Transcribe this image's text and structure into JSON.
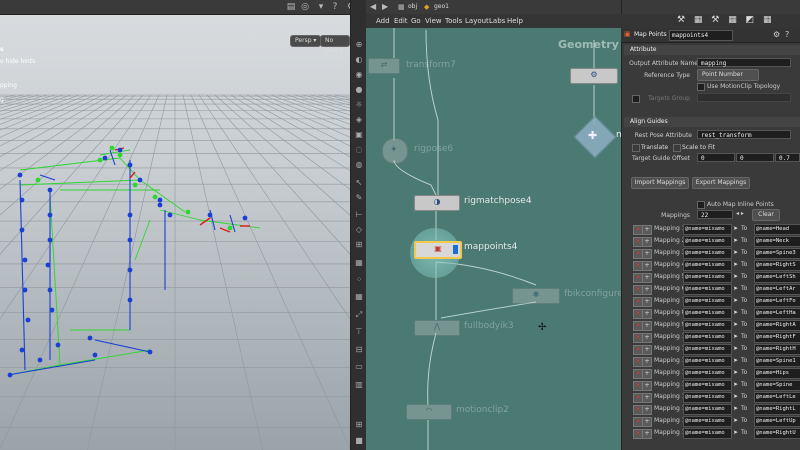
{
  "viewport": {
    "title_fragment": "s",
    "hint_text": "o hide hints",
    "label_mapping": "pping",
    "label_g": "g",
    "persp_button": "Persp ▾",
    "cam_button": "No cam ▾"
  },
  "network": {
    "path_obj": "obj",
    "path_geo": "geo1",
    "menu": [
      "Add",
      "Edit",
      "Go",
      "View",
      "Tools",
      "Layout",
      "Labs",
      "Help"
    ],
    "context_label": "Geometry",
    "nodes": {
      "transform7": "transform7",
      "rigpose6": "rigpose6",
      "rigmatchpose4": "rigmatchpose4",
      "mappoints4": "mappoints4",
      "fbikconfigure": "fbikconfigure",
      "fullbodyik3": "fullbodyik3",
      "motionclip2": "motionclip2",
      "m_fragment": "m"
    }
  },
  "params": {
    "node_type": "Map Points",
    "node_name": "mappoints4",
    "section_attribute": "Attribute",
    "output_attr_label": "Output Attribute Name",
    "output_attr_value": "mapping",
    "ref_type_label": "Reference Type",
    "ref_type_value": "Point Number",
    "use_motionclip_label": "Use MotionClip Topology",
    "targets_group_label": "Targets Group",
    "section_align": "Align Guides",
    "rest_pose_label": "Rest Pose Attribute",
    "rest_pose_value": "rest_transform",
    "translate_label": "Translate",
    "scale_to_fit_label": "Scale to Fit",
    "target_offset_label": "Target Guide Offset",
    "offset_x": "0",
    "offset_y": "0",
    "offset_z": "0.7",
    "import_button": "Import Mappings",
    "export_button": "Export Mappings",
    "auto_map_label": "Auto Map Inline Points",
    "mappings_label": "Mappings",
    "mappings_count": "22",
    "clear_button": "Clear",
    "to_label": "To",
    "rows": [
      {
        "label": "Mapping 1",
        "src": "@name=mixamo",
        "dst": "@name=Head"
      },
      {
        "label": "Mapping 2",
        "src": "@name=mixamo",
        "dst": "@name=Neck"
      },
      {
        "label": "Mapping 3",
        "src": "@name=mixamo",
        "dst": "@name=Spine3"
      },
      {
        "label": "Mapping 4",
        "src": "@name=mixamo",
        "dst": "@name=RightS"
      },
      {
        "label": "Mapping 5",
        "src": "@name=mixamo",
        "dst": "@name=LeftSh"
      },
      {
        "label": "Mapping 6",
        "src": "@name=mixamo",
        "dst": "@name=LeftAr"
      },
      {
        "label": "Mapping 7",
        "src": "@name=mixamo",
        "dst": "@name=LeftFo"
      },
      {
        "label": "Mapping 8",
        "src": "@name=mixamo",
        "dst": "@name=LeftHa"
      },
      {
        "label": "Mapping 9",
        "src": "@name=mixamo",
        "dst": "@name=RightA"
      },
      {
        "label": "Mapping 10",
        "src": "@name=mixamo",
        "dst": "@name=RightF"
      },
      {
        "label": "Mapping 11",
        "src": "@name=mixamo",
        "dst": "@name=RightH"
      },
      {
        "label": "Mapping 12",
        "src": "@name=mixamo",
        "dst": "@name=Spine1"
      },
      {
        "label": "Mapping 13",
        "src": "@name=mixamo",
        "dst": "@name=Hips"
      },
      {
        "label": "Mapping 14",
        "src": "@name=mixamo",
        "dst": "@name=Spine"
      },
      {
        "label": "Mapping 15",
        "src": "@name=mixamo",
        "dst": "@name=LeftLe"
      },
      {
        "label": "Mapping 16",
        "src": "@name=mixamo",
        "dst": "@name=RightL"
      },
      {
        "label": "Mapping 17",
        "src": "@name=mixamo",
        "dst": "@name=LeftUp"
      },
      {
        "label": "Mapping 18",
        "src": "@name=mixamo",
        "dst": "@name=RightU"
      }
    ]
  },
  "colors": {
    "network_bg": "#4a7a72",
    "selected_node": "#f2c94c",
    "skeleton_blue": "#1a3fd6",
    "skeleton_green": "#2ed62e",
    "handle_red": "#e01b1b"
  }
}
